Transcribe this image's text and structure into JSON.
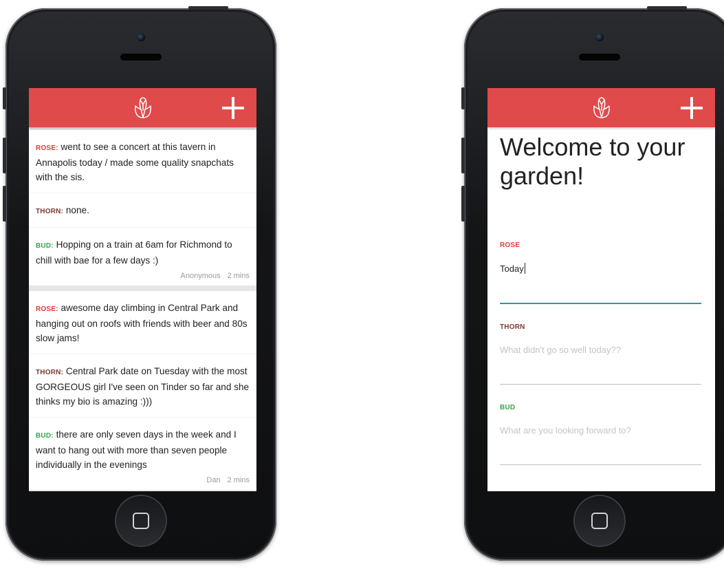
{
  "feed_screen": {
    "posts": [
      {
        "rose_tag": "ROSE:",
        "rose_text": " went to see a concert at this tavern in Annapolis today / made some quality snapchats with the sis.",
        "thorn_tag": "THORN:",
        "thorn_text": " none.",
        "bud_tag": "BUD:",
        "bud_text": " Hopping on a train at 6am for Richmond to chill with bae for a few days :)",
        "author": "Anonymous",
        "time": "2 mins"
      },
      {
        "rose_tag": "ROSE:",
        "rose_text": " awesome day climbing in Central Park and hanging out on roofs with friends with beer and 80s slow jams!",
        "thorn_tag": "THORN:",
        "thorn_text": " Central Park date on Tuesday with the most GORGEOUS girl I've seen on Tinder so far and she thinks my bio is amazing :)))",
        "bud_tag": "BUD:",
        "bud_text": " there are only seven days in the week and I want to hang out with more than seven people individually in the evenings",
        "author": "Dan",
        "time": "2 mins"
      }
    ]
  },
  "form_screen": {
    "welcome": "Welcome to your garden!",
    "rose_label": "ROSE",
    "rose_value": "Today",
    "thorn_label": "THORN",
    "thorn_placeholder": "What didn't go so well today??",
    "bud_label": "BUD",
    "bud_placeholder": "What are you looking forward to?"
  },
  "colors": {
    "appbar": "#e04a4a",
    "rose": "#e53935",
    "thorn": "#7a3b2e",
    "bud": "#3aa44a",
    "active_underline": "#2a9d96"
  },
  "icons": {
    "logo": "rose-bud-outline-icon",
    "add": "plus-icon",
    "home": "home-button-square-icon"
  }
}
